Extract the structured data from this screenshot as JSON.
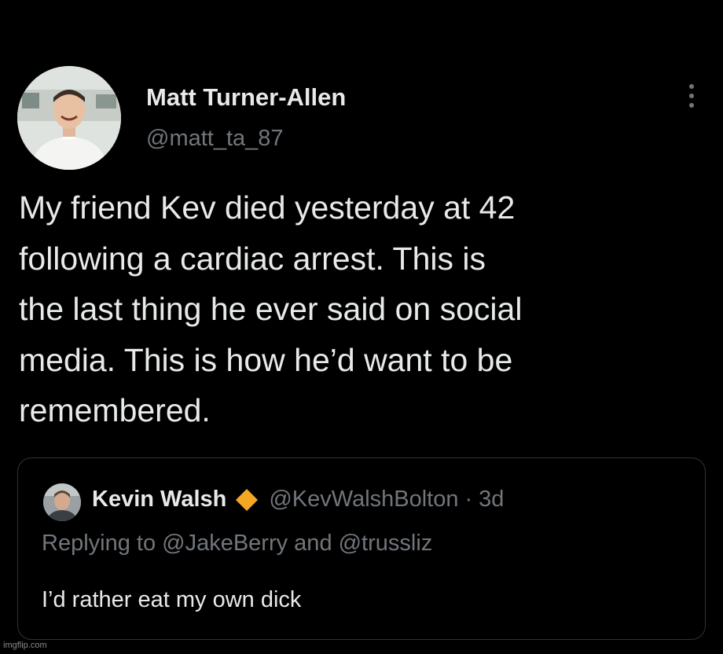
{
  "author": {
    "name": "Matt Turner-Allen",
    "handle": "@matt_ta_87",
    "avatar_icon": "profile-photo"
  },
  "menu": {
    "icon": "more-vertical-icon"
  },
  "tweet": {
    "text": "My friend Kev died yesterday at 42\nfollowing a cardiac arrest. This is\nthe last thing he ever said on social\nmedia. This is how he’d want to be\nremembered."
  },
  "quoted_tweet": {
    "name": "Kevin Walsh",
    "verified_icon": "orange-diamond-badge-icon",
    "handle": "@KevWalshBolton",
    "separator": "·",
    "time": "3d",
    "replying_to": "Replying to @JakeBerry and @trussliz",
    "text": "I’d rather eat my own dick"
  },
  "watermark": "imgflip.com",
  "colors": {
    "background": "#000000",
    "primary_text": "#e7e9ea",
    "secondary_text": "#71767b",
    "card_border": "#2f3336",
    "badge": "#f5a623"
  }
}
